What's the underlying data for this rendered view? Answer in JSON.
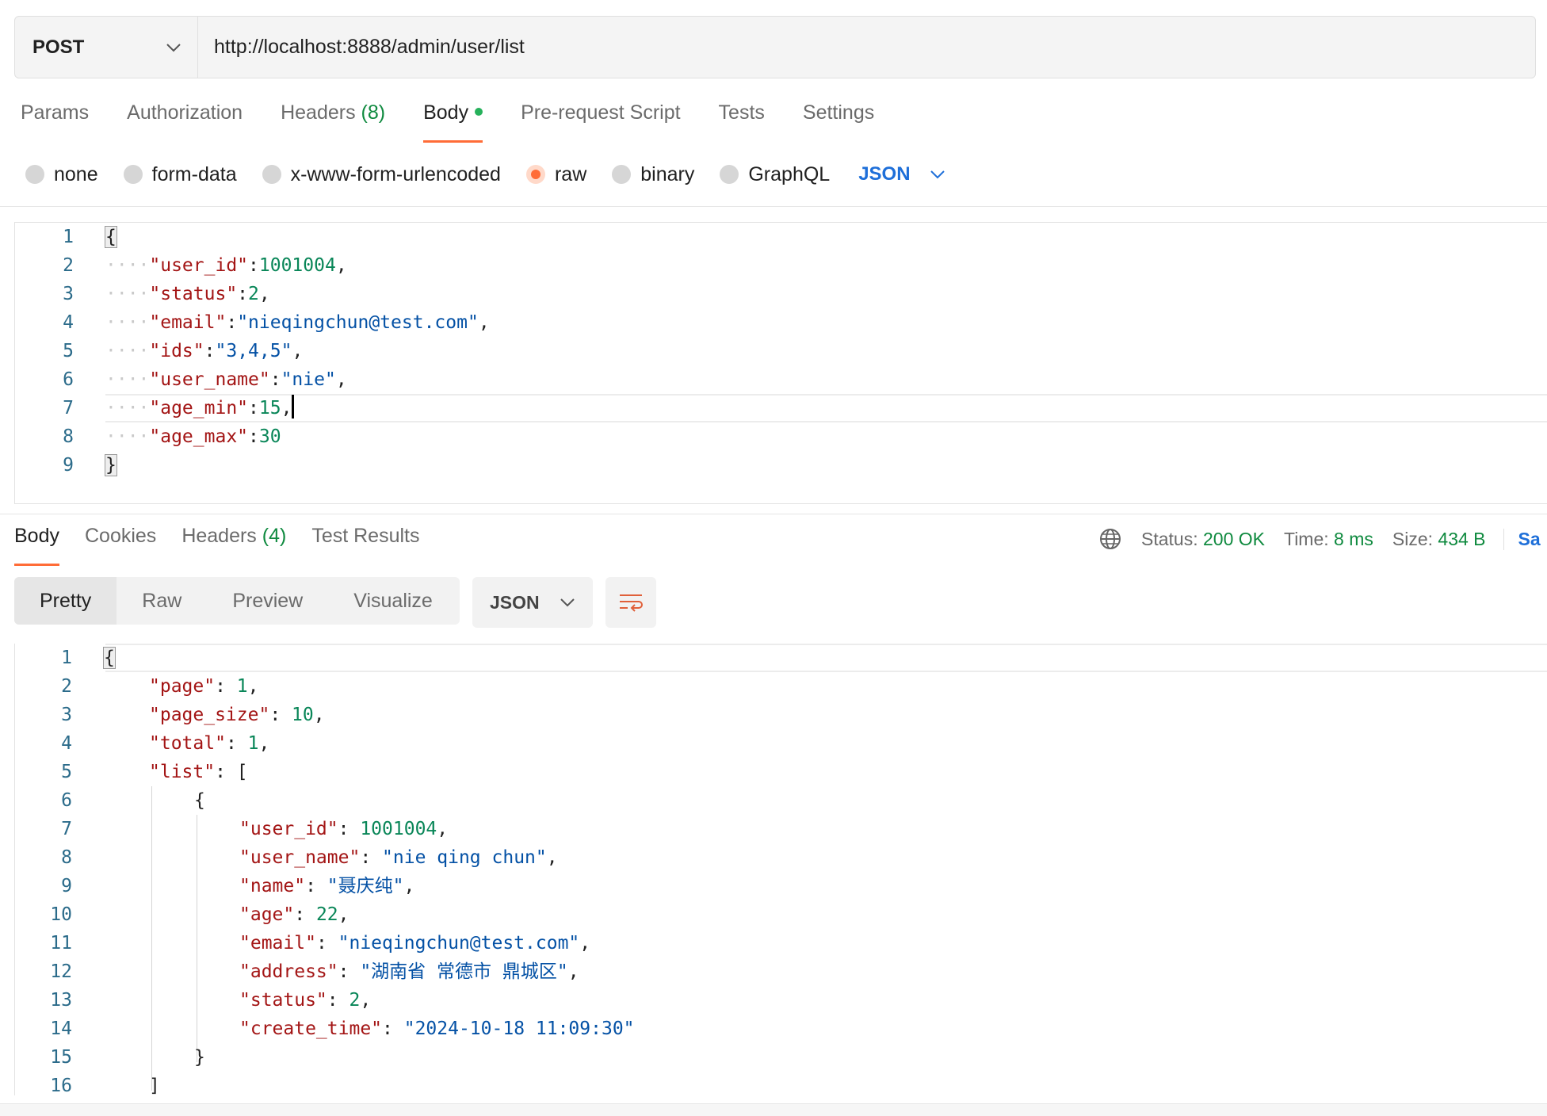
{
  "request": {
    "method": "POST",
    "url": "http://localhost:8888/admin/user/list"
  },
  "request_tabs": [
    {
      "label": "Params"
    },
    {
      "label": "Authorization"
    },
    {
      "label": "Headers",
      "count": "(8)"
    },
    {
      "label": "Body"
    },
    {
      "label": "Pre-request Script"
    },
    {
      "label": "Tests"
    },
    {
      "label": "Settings"
    }
  ],
  "body_types": [
    "none",
    "form-data",
    "x-www-form-urlencoded",
    "raw",
    "binary",
    "GraphQL"
  ],
  "body_language": "JSON",
  "request_body_lines": [
    {
      "num": "1",
      "parts": [
        [
          "brace",
          "{"
        ]
      ]
    },
    {
      "num": "2",
      "parts": [
        [
          "ws",
          "····"
        ],
        [
          "k",
          "\"user_id\""
        ],
        [
          "p",
          ":"
        ],
        [
          "n",
          "1001004"
        ],
        [
          "p",
          ","
        ]
      ]
    },
    {
      "num": "3",
      "parts": [
        [
          "ws",
          "····"
        ],
        [
          "k",
          "\"status\""
        ],
        [
          "p",
          ":"
        ],
        [
          "n",
          "2"
        ],
        [
          "p",
          ","
        ]
      ]
    },
    {
      "num": "4",
      "parts": [
        [
          "ws",
          "····"
        ],
        [
          "k",
          "\"email\""
        ],
        [
          "p",
          ":"
        ],
        [
          "s",
          "\"nieqingchun@test.com\""
        ],
        [
          "p",
          ","
        ]
      ]
    },
    {
      "num": "5",
      "parts": [
        [
          "ws",
          "····"
        ],
        [
          "k",
          "\"ids\""
        ],
        [
          "p",
          ":"
        ],
        [
          "s",
          "\"3,4,5\""
        ],
        [
          "p",
          ","
        ]
      ]
    },
    {
      "num": "6",
      "parts": [
        [
          "ws",
          "····"
        ],
        [
          "k",
          "\"user_name\""
        ],
        [
          "p",
          ":"
        ],
        [
          "s",
          "\"nie\""
        ],
        [
          "p",
          ","
        ]
      ]
    },
    {
      "num": "7",
      "parts": [
        [
          "ws",
          "····"
        ],
        [
          "k",
          "\"age_min\""
        ],
        [
          "p",
          ":"
        ],
        [
          "n",
          "15"
        ],
        [
          "p",
          ","
        ],
        [
          "cursor",
          ""
        ]
      ],
      "active": true
    },
    {
      "num": "8",
      "parts": [
        [
          "ws",
          "····"
        ],
        [
          "k",
          "\"age_max\""
        ],
        [
          "p",
          ":"
        ],
        [
          "n",
          "30"
        ]
      ]
    },
    {
      "num": "9",
      "parts": [
        [
          "brace",
          "}"
        ]
      ]
    }
  ],
  "response_tabs": [
    {
      "label": "Body"
    },
    {
      "label": "Cookies"
    },
    {
      "label": "Headers",
      "count": "(4)"
    },
    {
      "label": "Test Results"
    }
  ],
  "response_status": {
    "status_label": "Status:",
    "status_value": "200 OK",
    "time_label": "Time:",
    "time_value": "8 ms",
    "size_label": "Size:",
    "size_value": "434 B",
    "save_label": "Sa"
  },
  "view_modes": [
    "Pretty",
    "Raw",
    "Preview",
    "Visualize"
  ],
  "response_format": "JSON",
  "response_body_lines": [
    {
      "num": "1",
      "indent": 0,
      "parts": [
        [
          "brace",
          "{"
        ]
      ],
      "active": true
    },
    {
      "num": "2",
      "indent": 1,
      "parts": [
        [
          "k",
          "\"page\""
        ],
        [
          "p",
          ": "
        ],
        [
          "n",
          "1"
        ],
        [
          "p",
          ","
        ]
      ]
    },
    {
      "num": "3",
      "indent": 1,
      "parts": [
        [
          "k",
          "\"page_size\""
        ],
        [
          "p",
          ": "
        ],
        [
          "n",
          "10"
        ],
        [
          "p",
          ","
        ]
      ]
    },
    {
      "num": "4",
      "indent": 1,
      "parts": [
        [
          "k",
          "\"total\""
        ],
        [
          "p",
          ": "
        ],
        [
          "n",
          "1"
        ],
        [
          "p",
          ","
        ]
      ]
    },
    {
      "num": "5",
      "indent": 1,
      "parts": [
        [
          "k",
          "\"list\""
        ],
        [
          "p",
          ": ["
        ]
      ]
    },
    {
      "num": "6",
      "indent": 2,
      "parts": [
        [
          "p",
          "{"
        ]
      ]
    },
    {
      "num": "7",
      "indent": 3,
      "parts": [
        [
          "k",
          "\"user_id\""
        ],
        [
          "p",
          ": "
        ],
        [
          "n",
          "1001004"
        ],
        [
          "p",
          ","
        ]
      ]
    },
    {
      "num": "8",
      "indent": 3,
      "parts": [
        [
          "k",
          "\"user_name\""
        ],
        [
          "p",
          ": "
        ],
        [
          "s",
          "\"nie qing chun\""
        ],
        [
          "p",
          ","
        ]
      ]
    },
    {
      "num": "9",
      "indent": 3,
      "parts": [
        [
          "k",
          "\"name\""
        ],
        [
          "p",
          ": "
        ],
        [
          "s",
          "\"聂庆纯\""
        ],
        [
          "p",
          ","
        ]
      ]
    },
    {
      "num": "10",
      "indent": 3,
      "parts": [
        [
          "k",
          "\"age\""
        ],
        [
          "p",
          ": "
        ],
        [
          "n",
          "22"
        ],
        [
          "p",
          ","
        ]
      ]
    },
    {
      "num": "11",
      "indent": 3,
      "parts": [
        [
          "k",
          "\"email\""
        ],
        [
          "p",
          ": "
        ],
        [
          "s",
          "\"nieqingchun@test.com\""
        ],
        [
          "p",
          ","
        ]
      ]
    },
    {
      "num": "12",
      "indent": 3,
      "parts": [
        [
          "k",
          "\"address\""
        ],
        [
          "p",
          ": "
        ],
        [
          "s",
          "\"湖南省 常德市 鼎城区\""
        ],
        [
          "p",
          ","
        ]
      ]
    },
    {
      "num": "13",
      "indent": 3,
      "parts": [
        [
          "k",
          "\"status\""
        ],
        [
          "p",
          ": "
        ],
        [
          "n",
          "2"
        ],
        [
          "p",
          ","
        ]
      ]
    },
    {
      "num": "14",
      "indent": 3,
      "parts": [
        [
          "k",
          "\"create_time\""
        ],
        [
          "p",
          ": "
        ],
        [
          "s",
          "\"2024-10-18 11:09:30\""
        ]
      ]
    },
    {
      "num": "15",
      "indent": 2,
      "parts": [
        [
          "p",
          "}"
        ]
      ]
    },
    {
      "num": "16",
      "indent": 1,
      "parts": [
        [
          "p",
          "]"
        ]
      ]
    }
  ],
  "icons": {
    "method_dropdown": "chevron-down-icon",
    "language_dropdown": "chevron-down-icon",
    "network": "globe-icon",
    "wrap": "wrap-lines-icon"
  },
  "colors": {
    "accent": "#ff6c37",
    "success": "#0f8a3f",
    "link": "#1e6fd9",
    "json_key": "#a31515",
    "json_number": "#098658",
    "json_string": "#0451a5"
  }
}
